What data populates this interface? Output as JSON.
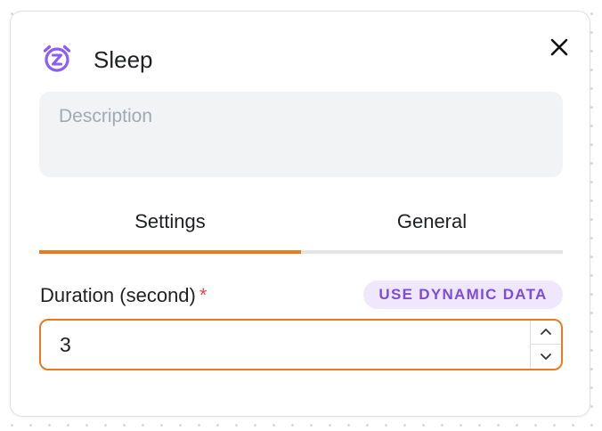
{
  "panel": {
    "title": "Sleep",
    "icon": "alarm-clock-z-icon",
    "accent_color": "#8b5cf6"
  },
  "description": {
    "placeholder": "Description",
    "value": ""
  },
  "tabs": [
    {
      "label": "Settings",
      "active": true
    },
    {
      "label": "General",
      "active": false
    }
  ],
  "duration": {
    "label": "Duration (second)",
    "required_mark": "*",
    "value": "3",
    "dynamic_button": "USE DYNAMIC DATA"
  },
  "colors": {
    "tab_active": "#ea7a1f",
    "input_focus": "#ea7a1f",
    "dynamic_bg": "#efe8fd",
    "dynamic_text": "#7c4ddb",
    "required": "#e5484d"
  }
}
